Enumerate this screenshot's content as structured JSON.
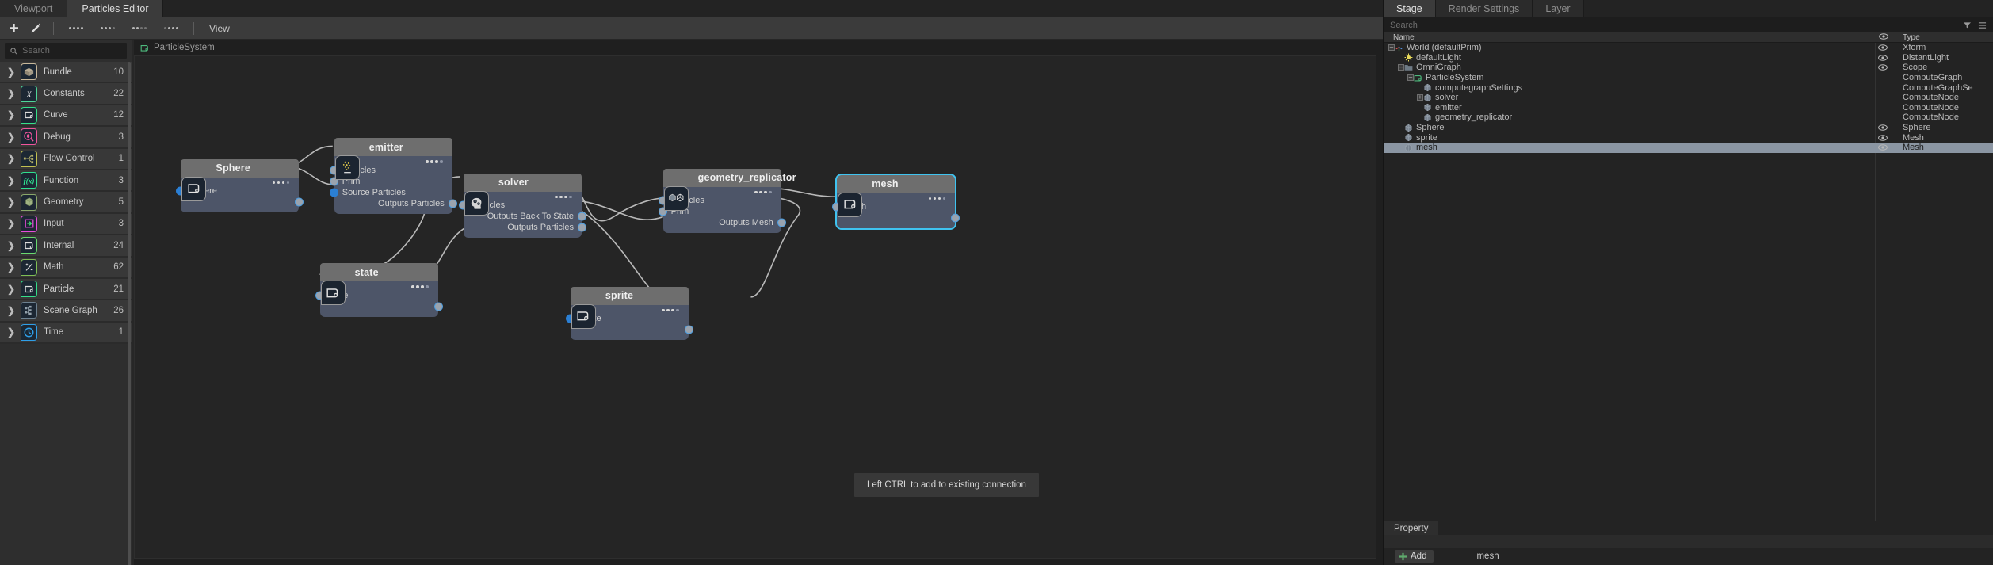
{
  "editor": {
    "tabs": [
      {
        "label": "Viewport",
        "active": false
      },
      {
        "label": "Particles Editor",
        "active": true
      }
    ],
    "toolbar": {
      "add_icon": "plus-icon",
      "edit_icon": "pencil-icon",
      "view_label": "View"
    },
    "library": {
      "search_placeholder": "Search",
      "items": [
        {
          "label": "Bundle",
          "count": "10",
          "icon": "bundle-icon",
          "color": "#c8b89a"
        },
        {
          "label": "Constants",
          "count": "22",
          "icon": "constants-icon",
          "color": "#4fd699"
        },
        {
          "label": "Curve",
          "count": "12",
          "icon": "curve-icon",
          "color": "#35e08a"
        },
        {
          "label": "Debug",
          "count": "3",
          "icon": "debug-icon",
          "color": "#f0559c"
        },
        {
          "label": "Flow Control",
          "count": "1",
          "icon": "flow-control-icon",
          "color": "#c2c050"
        },
        {
          "label": "Function",
          "count": "3",
          "icon": "function-icon",
          "color": "#2fe08f"
        },
        {
          "label": "Geometry",
          "count": "5",
          "icon": "geometry-icon",
          "color": "#8ba86a"
        },
        {
          "label": "Input",
          "count": "3",
          "icon": "input-icon",
          "color": "#e94ddd"
        },
        {
          "label": "Internal",
          "count": "24",
          "icon": "internal-icon",
          "color": "#69d96f"
        },
        {
          "label": "Math",
          "count": "62",
          "icon": "math-icon",
          "color": "#7fbf54"
        },
        {
          "label": "Particle",
          "count": "21",
          "icon": "particle-icon",
          "color": "#35e08a"
        },
        {
          "label": "Scene Graph",
          "count": "26",
          "icon": "scene-graph-icon",
          "color": "#6d8190"
        },
        {
          "label": "Time",
          "count": "1",
          "icon": "time-icon",
          "color": "#2f9fe8"
        }
      ]
    },
    "graph": {
      "breadcrumb": "ParticleSystem",
      "hint": "Left CTRL to add to existing connection",
      "nodes": [
        {
          "id": "sphere",
          "title": "Sphere",
          "icon": "prim-icon",
          "inputs": [
            {
              "label": "Sphere",
              "filled": true
            }
          ],
          "outputs": [
            {
              "label": ""
            }
          ]
        },
        {
          "id": "emitter",
          "title": "emitter",
          "icon": "emitter-icon",
          "inputs": [
            {
              "label": "Particles",
              "filled": false
            },
            {
              "label": "Prim",
              "filled": false
            },
            {
              "label": "Source Particles",
              "filled": true
            }
          ],
          "outputs": [
            {
              "label": "Outputs Particles"
            }
          ]
        },
        {
          "id": "state",
          "title": "state",
          "icon": "prim-icon",
          "inputs": [
            {
              "label": "State",
              "filled": false
            }
          ],
          "outputs": [
            {
              "label": ""
            }
          ]
        },
        {
          "id": "solver",
          "title": "solver",
          "icon": "solver-icon",
          "inputs": [
            {
              "label": "Particles",
              "filled": false
            }
          ],
          "outputs": [
            {
              "label": "Outputs Back To State"
            },
            {
              "label": "Outputs Particles"
            }
          ]
        },
        {
          "id": "sprite",
          "title": "sprite",
          "icon": "prim-icon",
          "inputs": [
            {
              "label": "Sprite",
              "filled": true
            }
          ],
          "outputs": [
            {
              "label": ""
            }
          ]
        },
        {
          "id": "geometry_replicator",
          "title": "geometry_replicator",
          "icon": "replicator-icon",
          "inputs": [
            {
              "label": "Particles",
              "filled": false
            },
            {
              "label": "Prim",
              "filled": false
            }
          ],
          "outputs": [
            {
              "label": "Outputs Mesh"
            }
          ]
        },
        {
          "id": "mesh",
          "title": "mesh",
          "icon": "prim-icon",
          "selected": true,
          "inputs": [
            {
              "label": "Mesh",
              "filled": false
            }
          ],
          "outputs": [
            {
              "label": ""
            }
          ]
        }
      ]
    }
  },
  "right_panel": {
    "tabs": [
      {
        "label": "Stage",
        "active": true
      },
      {
        "label": "Render Settings",
        "active": false
      },
      {
        "label": "Layer",
        "active": false
      }
    ],
    "search_placeholder": "Search",
    "columns": {
      "name": "Name",
      "type": "Type"
    },
    "tree": [
      {
        "name": "World (defaultPrim)",
        "type": "Xform",
        "depth": 0,
        "expander": "minus",
        "icon": "axis-icon",
        "eye": true
      },
      {
        "name": "defaultLight",
        "type": "DistantLight",
        "depth": 1,
        "expander": "none",
        "icon": "light-icon",
        "eye": true
      },
      {
        "name": "OmniGraph",
        "type": "Scope",
        "depth": 1,
        "expander": "minus",
        "icon": "folder-icon",
        "eye": true
      },
      {
        "name": "ParticleSystem",
        "type": "ComputeGraph",
        "depth": 2,
        "expander": "minus",
        "icon": "graph-icon",
        "eye": false
      },
      {
        "name": "computegraphSettings",
        "type": "ComputeGraphSe",
        "depth": 3,
        "expander": "none",
        "icon": "prim-cube",
        "eye": false
      },
      {
        "name": "solver",
        "type": "ComputeNode",
        "depth": 3,
        "expander": "plus",
        "icon": "prim-cube",
        "eye": false
      },
      {
        "name": "emitter",
        "type": "ComputeNode",
        "depth": 3,
        "expander": "none",
        "icon": "prim-cube",
        "eye": false
      },
      {
        "name": "geometry_replicator",
        "type": "ComputeNode",
        "depth": 3,
        "expander": "none",
        "icon": "prim-cube",
        "eye": false
      },
      {
        "name": "Sphere",
        "type": "Sphere",
        "depth": 1,
        "expander": "none",
        "icon": "prim-cube",
        "eye": true
      },
      {
        "name": "sprite",
        "type": "Mesh",
        "depth": 1,
        "expander": "none",
        "icon": "prim-cube",
        "eye": true
      },
      {
        "name": "mesh",
        "type": "Mesh",
        "depth": 1,
        "expander": "none",
        "icon": "prim-cube",
        "eye": true,
        "selected": true
      }
    ],
    "property": {
      "tab_label": "Property",
      "add_label": "Add",
      "selected_prim": "mesh"
    }
  },
  "colors": {
    "selection_outline": "#3fc3f0",
    "node_body": "#4d5568",
    "node_header": "#6e6e6e",
    "accent_green": "#4fa86a"
  }
}
